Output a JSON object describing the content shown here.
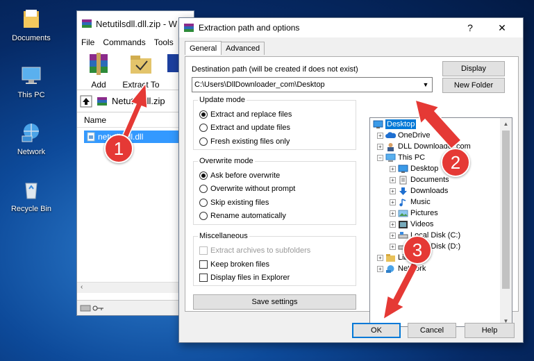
{
  "desktop": {
    "icons": [
      {
        "label": "Documents"
      },
      {
        "label": "This PC"
      },
      {
        "label": "Network"
      },
      {
        "label": "Recycle Bin"
      }
    ]
  },
  "winrar": {
    "title": "Netutilsdll.dll.zip - W",
    "menu": [
      "File",
      "Commands",
      "Tools"
    ],
    "toolbar": {
      "add": "Add",
      "extract_to": "Extract To"
    },
    "address": "Netutilsdll.zip",
    "column_name": "Name",
    "file": "netutilsdll.dll"
  },
  "dialog": {
    "title": "Extraction path and options",
    "help_glyph": "?",
    "close_glyph": "✕",
    "tabs": [
      "General",
      "Advanced"
    ],
    "dest_label": "Destination path (will be created if does not exist)",
    "dest_value": "C:\\Users\\DllDownloader_com\\Desktop",
    "display_button": "Display",
    "new_folder_button": "New Folder",
    "update_mode": {
      "title": "Update mode",
      "options": [
        "Extract and replace files",
        "Extract and update files",
        "Fresh existing files only"
      ],
      "selected": "Extract and replace files"
    },
    "overwrite_mode": {
      "title": "Overwrite mode",
      "options": [
        "Ask before overwrite",
        "Overwrite without prompt",
        "Skip existing files",
        "Rename automatically"
      ],
      "selected": "Ask before overwrite"
    },
    "misc": {
      "title": "Miscellaneous",
      "options": [
        "Extract archives to subfolders",
        "Keep broken files",
        "Display files in Explorer"
      ]
    },
    "save_settings": "Save settings",
    "tree": [
      "Desktop",
      "OneDrive",
      "DLL Downloader.com",
      "This PC",
      "Desktop",
      "Documents",
      "Downloads",
      "Music",
      "Pictures",
      "Videos",
      "Local Disk (C:)",
      "Local Disk (D:)",
      "Libraries",
      "Network"
    ],
    "ok": "OK",
    "cancel": "Cancel",
    "help": "Help"
  },
  "callouts": [
    "1",
    "2",
    "3"
  ],
  "colors": {
    "callout": "#e53935",
    "selection": "#0078d7"
  }
}
